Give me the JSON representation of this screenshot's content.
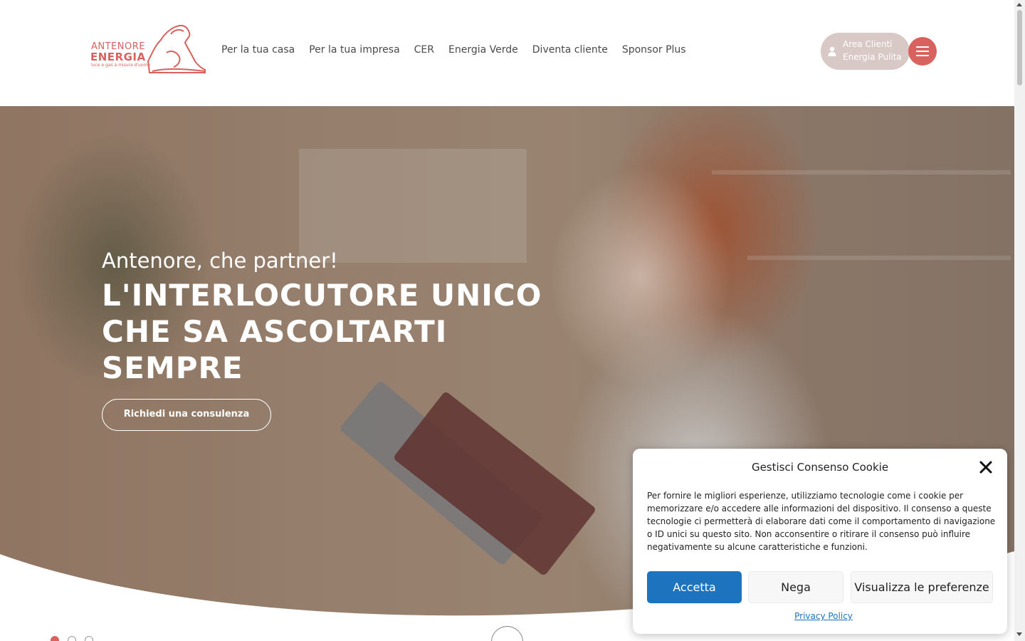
{
  "brand": {
    "name_line1": "ANTENORE",
    "name_line2": "ENERGIA",
    "tagline": "luce e gas a misura d'uomo",
    "color": "#d9625e"
  },
  "nav": {
    "items": [
      {
        "label": "Per la tua casa"
      },
      {
        "label": "Per la tua impresa"
      },
      {
        "label": "CER"
      },
      {
        "label": "Energia Verde"
      },
      {
        "label": "Diventa cliente"
      },
      {
        "label": "Sponsor Plus"
      }
    ]
  },
  "header": {
    "area_clienti_line1": "Area Clienti",
    "area_clienti_line2": "Energia Pulita",
    "user_icon": "user-icon",
    "menu_icon": "hamburger-menu-icon"
  },
  "hero": {
    "subtitle": "Antenore, che partner!",
    "title": "L'INTERLOCUTORE UNICO CHE SA ASCOLTARTI SEMPRE",
    "cta_label": "Richiedi una consulenza",
    "slides": 3,
    "active_slide": 1
  },
  "cookie": {
    "title": "Gestisci Consenso Cookie",
    "text": "Per fornire le migliori esperienze, utilizziamo tecnologie come i cookie per memorizzare e/o accedere alle informazioni del dispositivo. Il consenso a queste tecnologie ci permetterà di elaborare dati come il comportamento di navigazione o ID unici su questo sito. Non acconsentire o ritirare il consenso può influire negativamente su alcune caratteristiche e funzioni.",
    "accept_label": "Accetta",
    "deny_label": "Nega",
    "preferences_label": "Visualizza le preferenze",
    "privacy_label": "Privacy Policy",
    "accept_color": "#1e73be"
  }
}
